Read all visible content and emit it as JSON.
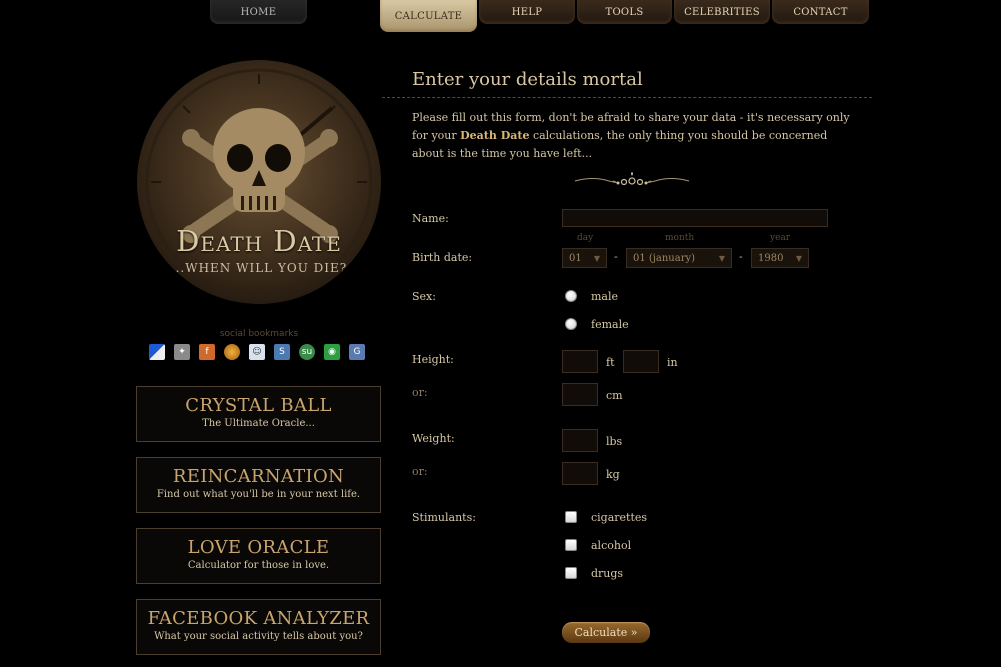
{
  "nav": {
    "home": "HOME",
    "calculate": "CALCULATE",
    "help": "HELP",
    "tools": "TOOLS",
    "celebrities": "CELEBRITIES",
    "contact": "CONTACT"
  },
  "logo": {
    "title": "Death Date",
    "subtitle": "...WHEN WILL YOU DIE?"
  },
  "social": {
    "label": "social bookmarks",
    "icons": [
      "delicious-icon",
      "digg-icon",
      "furl-icon",
      "stumble-icon",
      "reddit-icon",
      "spurl-icon",
      "stumbleupon-icon",
      "technorati-icon",
      "google-icon"
    ]
  },
  "side_boxes": [
    {
      "title": "CRYSTAL BALL",
      "subtitle": "The Ultimate Oracle..."
    },
    {
      "title": "REINCARNATION",
      "subtitle": "Find out what you'll be in your next life."
    },
    {
      "title": "LOVE ORACLE",
      "subtitle": "Calculator for those in love."
    },
    {
      "title": "FACEBOOK ANALYZER",
      "subtitle": "What your social activity tells about you?"
    }
  ],
  "main": {
    "title": "Enter your details mortal",
    "intro_before": "Please fill out this form, don't be afraid to share your data - it's necessary only for your ",
    "intro_bold": "Death Date",
    "intro_after": " calculations, the only thing you should be concerned about is the time you have left..."
  },
  "form": {
    "name_label": "Name:",
    "name_value": "",
    "birth_label": "Birth date:",
    "day_caption": "day",
    "month_caption": "month",
    "year_caption": "year",
    "day_value": "01",
    "month_value": "01 (january)",
    "year_value": "1980",
    "dash": "-",
    "sex_label": "Sex:",
    "male": "male",
    "female": "female",
    "height_label": "Height:",
    "or": "or:",
    "ft": "ft",
    "in": "in",
    "cm": "cm",
    "weight_label": "Weight:",
    "lbs": "lbs",
    "kg": "kg",
    "stimulants_label": "Stimulants:",
    "cigarettes": "cigarettes",
    "alcohol": "alcohol",
    "drugs": "drugs",
    "submit": "Calculate »"
  },
  "colors": {
    "background": "#000000",
    "accent": "#c9a56e",
    "text": "#d6c7a6",
    "button": "#7a5020"
  }
}
